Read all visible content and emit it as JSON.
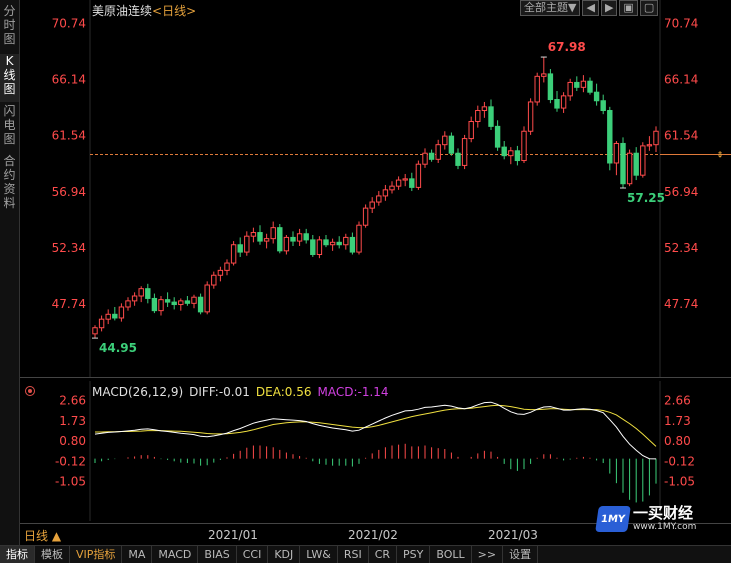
{
  "left_tabs": [
    {
      "label": "分时图",
      "active": false
    },
    {
      "label": "K线图",
      "active": true
    },
    {
      "label": "闪电图",
      "active": false
    },
    {
      "label": "合约资料",
      "active": false
    }
  ],
  "header": {
    "instrument": "美原油连续",
    "period": "<日线>",
    "theme_label": "全部主题▼",
    "nav_buttons": [
      "◀",
      "▶",
      "▣",
      "▢"
    ]
  },
  "price_axis": {
    "ticks": [
      "70.74",
      "66.14",
      "61.54",
      "56.94",
      "52.34",
      "47.74"
    ]
  },
  "annotations": {
    "high": "67.98",
    "low_start": "44.95",
    "low_recent": "57.25"
  },
  "current_price_level": 60.0,
  "macd": {
    "legend_name": "MACD(26,12,9)",
    "diff": "DIFF:-0.01",
    "dea": "DEA:0.56",
    "macd": "MACD:-1.14",
    "ticks": [
      "2.66",
      "1.73",
      "0.80",
      "-0.12",
      "-1.05"
    ]
  },
  "date_axis": {
    "period_selector": "日线 ▲",
    "dates": [
      "2021/01",
      "2021/02",
      "2021/03"
    ]
  },
  "bottom_tabs": [
    {
      "label": "指标",
      "active": true
    },
    {
      "label": "模板",
      "active": false
    },
    {
      "label": "VIP指标",
      "active": false,
      "vip": true
    },
    {
      "label": "MA",
      "active": false
    },
    {
      "label": "MACD",
      "active": false
    },
    {
      "label": "BIAS",
      "active": false
    },
    {
      "label": "CCI",
      "active": false
    },
    {
      "label": "KDJ",
      "active": false
    },
    {
      "label": "LW&",
      "active": false
    },
    {
      "label": "RSI",
      "active": false
    },
    {
      "label": "CR",
      "active": false
    },
    {
      "label": "PSY",
      "active": false
    },
    {
      "label": "BOLL",
      "active": false
    },
    {
      "label": ">>",
      "active": false
    },
    {
      "label": "设置",
      "active": false
    }
  ],
  "watermark": {
    "badge": "1MY",
    "name": "一买财经",
    "url": "www.1MY.com"
  },
  "colors": {
    "up": "#ff4b4b",
    "down": "#3ccf7a",
    "axis_text": "#ff4b4b",
    "macd_diff": "#ffffff",
    "macd_dea": "#f0e040",
    "macd_label": "#d040e0"
  },
  "chart_data": {
    "type": "candlestick",
    "ylim": [
      42.5,
      72.0
    ],
    "macd_ylim": [
      -2.3,
      3.0
    ],
    "candles": [
      {
        "o": 45.3,
        "h": 46.0,
        "l": 44.95,
        "c": 45.8
      },
      {
        "o": 45.8,
        "h": 46.8,
        "l": 45.5,
        "c": 46.5
      },
      {
        "o": 46.5,
        "h": 47.3,
        "l": 46.1,
        "c": 46.9
      },
      {
        "o": 46.9,
        "h": 47.5,
        "l": 46.4,
        "c": 46.6
      },
      {
        "o": 46.6,
        "h": 47.8,
        "l": 46.3,
        "c": 47.5
      },
      {
        "o": 47.5,
        "h": 48.3,
        "l": 47.2,
        "c": 48.0
      },
      {
        "o": 48.0,
        "h": 48.7,
        "l": 47.6,
        "c": 48.4
      },
      {
        "o": 48.4,
        "h": 49.2,
        "l": 47.9,
        "c": 49.0
      },
      {
        "o": 49.0,
        "h": 49.4,
        "l": 47.8,
        "c": 48.2
      },
      {
        "o": 48.2,
        "h": 48.6,
        "l": 47.0,
        "c": 47.2
      },
      {
        "o": 47.2,
        "h": 48.4,
        "l": 46.8,
        "c": 48.1
      },
      {
        "o": 48.1,
        "h": 48.7,
        "l": 47.5,
        "c": 47.9
      },
      {
        "o": 47.9,
        "h": 48.3,
        "l": 47.3,
        "c": 47.7
      },
      {
        "o": 47.7,
        "h": 48.2,
        "l": 47.2,
        "c": 48.0
      },
      {
        "o": 48.0,
        "h": 48.4,
        "l": 47.6,
        "c": 47.8
      },
      {
        "o": 47.8,
        "h": 48.5,
        "l": 47.4,
        "c": 48.3
      },
      {
        "o": 48.3,
        "h": 48.6,
        "l": 46.9,
        "c": 47.1
      },
      {
        "o": 47.1,
        "h": 49.6,
        "l": 46.9,
        "c": 49.3
      },
      {
        "o": 49.3,
        "h": 50.4,
        "l": 49.0,
        "c": 50.1
      },
      {
        "o": 50.1,
        "h": 50.8,
        "l": 49.6,
        "c": 50.5
      },
      {
        "o": 50.5,
        "h": 51.4,
        "l": 50.1,
        "c": 51.1
      },
      {
        "o": 51.1,
        "h": 52.9,
        "l": 50.9,
        "c": 52.6
      },
      {
        "o": 52.6,
        "h": 53.2,
        "l": 51.6,
        "c": 52.0
      },
      {
        "o": 52.0,
        "h": 53.7,
        "l": 51.7,
        "c": 53.3
      },
      {
        "o": 53.3,
        "h": 54.0,
        "l": 52.8,
        "c": 53.6
      },
      {
        "o": 53.6,
        "h": 54.2,
        "l": 52.6,
        "c": 52.9
      },
      {
        "o": 52.9,
        "h": 53.5,
        "l": 52.3,
        "c": 53.1
      },
      {
        "o": 53.1,
        "h": 54.5,
        "l": 52.7,
        "c": 54.0
      },
      {
        "o": 54.0,
        "h": 54.3,
        "l": 51.9,
        "c": 52.1
      },
      {
        "o": 52.1,
        "h": 53.4,
        "l": 51.8,
        "c": 53.2
      },
      {
        "o": 53.2,
        "h": 53.7,
        "l": 52.5,
        "c": 52.9
      },
      {
        "o": 52.9,
        "h": 53.9,
        "l": 52.5,
        "c": 53.5
      },
      {
        "o": 53.5,
        "h": 53.9,
        "l": 52.7,
        "c": 53.0
      },
      {
        "o": 53.0,
        "h": 53.4,
        "l": 51.6,
        "c": 51.8
      },
      {
        "o": 51.8,
        "h": 53.3,
        "l": 51.5,
        "c": 53.0
      },
      {
        "o": 53.0,
        "h": 53.4,
        "l": 52.4,
        "c": 52.6
      },
      {
        "o": 52.6,
        "h": 53.1,
        "l": 52.1,
        "c": 52.8
      },
      {
        "o": 52.8,
        "h": 53.3,
        "l": 52.3,
        "c": 52.6
      },
      {
        "o": 52.6,
        "h": 53.5,
        "l": 52.2,
        "c": 53.2
      },
      {
        "o": 53.2,
        "h": 53.6,
        "l": 51.8,
        "c": 52.0
      },
      {
        "o": 52.0,
        "h": 54.5,
        "l": 51.8,
        "c": 54.2
      },
      {
        "o": 54.2,
        "h": 55.9,
        "l": 54.0,
        "c": 55.6
      },
      {
        "o": 55.6,
        "h": 56.5,
        "l": 55.2,
        "c": 56.1
      },
      {
        "o": 56.1,
        "h": 57.0,
        "l": 55.8,
        "c": 56.6
      },
      {
        "o": 56.6,
        "h": 57.5,
        "l": 56.2,
        "c": 57.1
      },
      {
        "o": 57.1,
        "h": 57.8,
        "l": 56.8,
        "c": 57.4
      },
      {
        "o": 57.4,
        "h": 58.2,
        "l": 57.1,
        "c": 57.9
      },
      {
        "o": 57.9,
        "h": 58.4,
        "l": 57.4,
        "c": 58.0
      },
      {
        "o": 58.0,
        "h": 58.5,
        "l": 57.0,
        "c": 57.3
      },
      {
        "o": 57.3,
        "h": 59.5,
        "l": 57.1,
        "c": 59.2
      },
      {
        "o": 59.2,
        "h": 60.5,
        "l": 58.9,
        "c": 60.1
      },
      {
        "o": 60.1,
        "h": 60.4,
        "l": 59.4,
        "c": 59.6
      },
      {
        "o": 59.6,
        "h": 61.2,
        "l": 59.3,
        "c": 60.8
      },
      {
        "o": 60.8,
        "h": 61.9,
        "l": 60.4,
        "c": 61.5
      },
      {
        "o": 61.5,
        "h": 61.8,
        "l": 59.9,
        "c": 60.1
      },
      {
        "o": 60.1,
        "h": 60.5,
        "l": 58.8,
        "c": 59.1
      },
      {
        "o": 59.1,
        "h": 61.6,
        "l": 58.8,
        "c": 61.3
      },
      {
        "o": 61.3,
        "h": 63.1,
        "l": 61.0,
        "c": 62.7
      },
      {
        "o": 62.7,
        "h": 64.0,
        "l": 62.2,
        "c": 63.6
      },
      {
        "o": 63.6,
        "h": 64.3,
        "l": 63.0,
        "c": 63.9
      },
      {
        "o": 63.9,
        "h": 64.5,
        "l": 62.0,
        "c": 62.3
      },
      {
        "o": 62.3,
        "h": 62.8,
        "l": 60.3,
        "c": 60.6
      },
      {
        "o": 60.6,
        "h": 61.1,
        "l": 59.6,
        "c": 59.9
      },
      {
        "o": 59.9,
        "h": 60.6,
        "l": 59.2,
        "c": 60.3
      },
      {
        "o": 60.3,
        "h": 60.7,
        "l": 59.1,
        "c": 59.5
      },
      {
        "o": 59.5,
        "h": 62.3,
        "l": 59.3,
        "c": 61.9
      },
      {
        "o": 61.9,
        "h": 64.6,
        "l": 61.6,
        "c": 64.3
      },
      {
        "o": 64.3,
        "h": 66.7,
        "l": 64.0,
        "c": 66.4
      },
      {
        "o": 66.4,
        "h": 67.98,
        "l": 65.9,
        "c": 66.6
      },
      {
        "o": 66.6,
        "h": 67.0,
        "l": 64.2,
        "c": 64.5
      },
      {
        "o": 64.5,
        "h": 65.2,
        "l": 63.5,
        "c": 63.8
      },
      {
        "o": 63.8,
        "h": 65.1,
        "l": 63.4,
        "c": 64.8
      },
      {
        "o": 64.8,
        "h": 66.2,
        "l": 64.4,
        "c": 65.9
      },
      {
        "o": 65.9,
        "h": 66.4,
        "l": 65.2,
        "c": 65.5
      },
      {
        "o": 65.5,
        "h": 66.5,
        "l": 65.1,
        "c": 66.0
      },
      {
        "o": 66.0,
        "h": 66.3,
        "l": 64.9,
        "c": 65.1
      },
      {
        "o": 65.1,
        "h": 65.8,
        "l": 64.0,
        "c": 64.4
      },
      {
        "o": 64.4,
        "h": 64.9,
        "l": 63.3,
        "c": 63.6
      },
      {
        "o": 63.6,
        "h": 63.9,
        "l": 58.7,
        "c": 59.3
      },
      {
        "o": 59.3,
        "h": 61.1,
        "l": 58.3,
        "c": 60.9
      },
      {
        "o": 60.9,
        "h": 61.4,
        "l": 57.25,
        "c": 57.6
      },
      {
        "o": 57.6,
        "h": 60.4,
        "l": 57.4,
        "c": 60.1
      },
      {
        "o": 60.1,
        "h": 60.6,
        "l": 57.9,
        "c": 58.3
      },
      {
        "o": 58.3,
        "h": 61.0,
        "l": 58.1,
        "c": 60.7
      },
      {
        "o": 60.7,
        "h": 61.5,
        "l": 60.3,
        "c": 60.8
      },
      {
        "o": 60.8,
        "h": 62.3,
        "l": 60.2,
        "c": 61.9
      }
    ],
    "diff_line": [
      1.12,
      1.16,
      1.2,
      1.22,
      1.24,
      1.27,
      1.3,
      1.34,
      1.36,
      1.32,
      1.27,
      1.24,
      1.2,
      1.16,
      1.13,
      1.1,
      1.02,
      1.0,
      1.04,
      1.1,
      1.17,
      1.28,
      1.38,
      1.5,
      1.62,
      1.7,
      1.76,
      1.82,
      1.8,
      1.78,
      1.76,
      1.74,
      1.7,
      1.6,
      1.52,
      1.46,
      1.4,
      1.36,
      1.32,
      1.26,
      1.3,
      1.44,
      1.58,
      1.72,
      1.86,
      1.98,
      2.08,
      2.18,
      2.2,
      2.26,
      2.34,
      2.36,
      2.4,
      2.44,
      2.4,
      2.32,
      2.28,
      2.34,
      2.46,
      2.56,
      2.58,
      2.48,
      2.3,
      2.14,
      2.04,
      2.02,
      2.12,
      2.26,
      2.36,
      2.38,
      2.3,
      2.22,
      2.22,
      2.26,
      2.28,
      2.26,
      2.2,
      2.1,
      1.78,
      1.44,
      1.02,
      0.66,
      0.38,
      0.14,
      0.0,
      -0.01
    ],
    "dea_line": [
      1.22,
      1.22,
      1.23,
      1.23,
      1.24,
      1.24,
      1.25,
      1.26,
      1.28,
      1.28,
      1.28,
      1.27,
      1.26,
      1.25,
      1.23,
      1.21,
      1.18,
      1.15,
      1.13,
      1.13,
      1.14,
      1.17,
      1.2,
      1.25,
      1.32,
      1.4,
      1.48,
      1.56,
      1.6,
      1.64,
      1.66,
      1.68,
      1.68,
      1.66,
      1.64,
      1.6,
      1.56,
      1.52,
      1.48,
      1.44,
      1.42,
      1.42,
      1.46,
      1.52,
      1.6,
      1.68,
      1.76,
      1.84,
      1.92,
      1.98,
      2.04,
      2.1,
      2.16,
      2.22,
      2.26,
      2.28,
      2.28,
      2.3,
      2.34,
      2.38,
      2.42,
      2.44,
      2.42,
      2.38,
      2.32,
      2.26,
      2.24,
      2.24,
      2.26,
      2.28,
      2.28,
      2.26,
      2.24,
      2.24,
      2.24,
      2.24,
      2.24,
      2.2,
      2.12,
      2.0,
      1.8,
      1.6,
      1.38,
      1.12,
      0.84,
      0.56
    ],
    "macd_bars": [
      -0.2,
      -0.12,
      -0.06,
      -0.02,
      0.0,
      0.06,
      0.1,
      0.16,
      0.16,
      0.08,
      -0.02,
      -0.06,
      -0.12,
      -0.18,
      -0.2,
      -0.22,
      -0.32,
      -0.3,
      -0.18,
      -0.06,
      0.06,
      0.22,
      0.36,
      0.5,
      0.6,
      0.6,
      0.56,
      0.52,
      0.4,
      0.28,
      0.2,
      0.12,
      0.04,
      -0.12,
      -0.24,
      -0.28,
      -0.32,
      -0.32,
      -0.32,
      -0.36,
      -0.24,
      0.04,
      0.24,
      0.4,
      0.52,
      0.6,
      0.64,
      0.68,
      0.56,
      0.56,
      0.6,
      0.52,
      0.48,
      0.44,
      0.28,
      0.08,
      0.0,
      0.08,
      0.24,
      0.36,
      0.32,
      0.08,
      -0.24,
      -0.48,
      -0.56,
      -0.48,
      -0.24,
      0.04,
      0.2,
      0.2,
      0.04,
      -0.08,
      -0.04,
      0.04,
      0.08,
      0.04,
      -0.08,
      -0.2,
      -0.68,
      -1.12,
      -1.56,
      -1.88,
      -2.0,
      -1.96,
      -1.68,
      -1.14
    ]
  }
}
